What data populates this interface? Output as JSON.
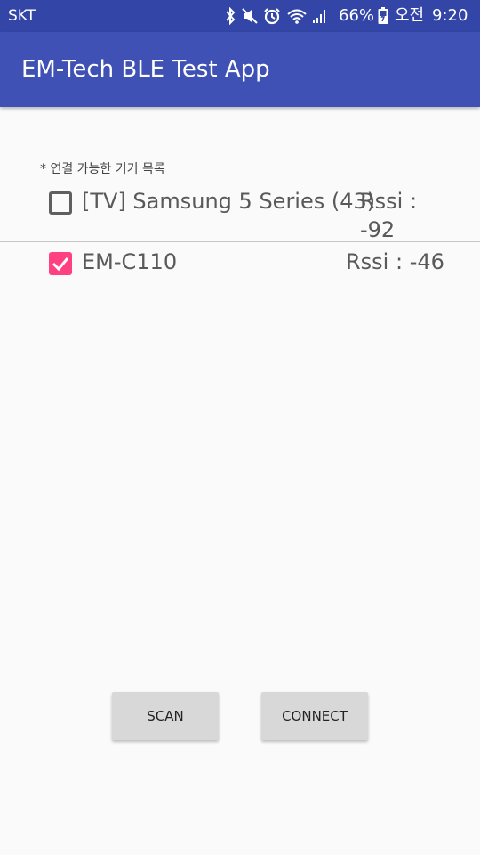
{
  "status_bar": {
    "carrier": "SKT",
    "battery_percent": "66%",
    "ampm": "오전",
    "time": "9:20",
    "icons": [
      "bluetooth-icon",
      "mute-icon",
      "alarm-icon",
      "wifi-icon",
      "signal-icon",
      "battery-icon"
    ]
  },
  "app_bar": {
    "title": "EM-Tech BLE Test App"
  },
  "device_list": {
    "header": "* 연결 가능한 기기 목록",
    "items": [
      {
        "name": "[TV] Samsung 5 Series (43)",
        "rssi_label": "Rssi :",
        "rssi_value": "-92",
        "checked": false
      },
      {
        "name": "EM-C110",
        "rssi_text": "Rssi : -46",
        "checked": true
      }
    ]
  },
  "buttons": {
    "scan": "SCAN",
    "connect": "CONNECT"
  },
  "colors": {
    "status_bar": "#3346a8",
    "app_bar": "#3f51b5",
    "accent_checkbox": "#ff4081",
    "button_bg": "#d8d8d8",
    "background": "#fafafa"
  }
}
